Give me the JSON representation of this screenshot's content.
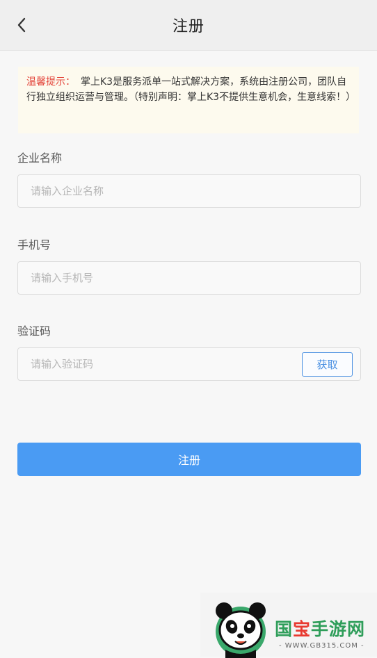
{
  "nav": {
    "title": "注册",
    "back_icon": "chevron-left-icon"
  },
  "notice": {
    "lead": "温馨提示：",
    "body": "掌上K3是服务派单一站式解决方案，系统由注册公司，团队自行独立组织运营与管理。（特别声明：掌上K3不提供生意机会，生意线索！）"
  },
  "form": {
    "company": {
      "label": "企业名称",
      "placeholder": "请输入企业名称"
    },
    "phone": {
      "label": "手机号",
      "placeholder": "请输入手机号"
    },
    "code": {
      "label": "验证码",
      "placeholder": "请输入验证码",
      "get_label": "获取"
    },
    "submit_label": "注册"
  },
  "watermark": {
    "brand_prefix": "国",
    "brand_bao": "宝",
    "brand_suffix": "手游网",
    "url": "- WWW.GB315.COM -",
    "mascot_icon": "panda-icon"
  },
  "colors": {
    "accent": "#4a9bf3",
    "notice_bg": "#fdfaee",
    "notice_lead": "#e3443a"
  }
}
